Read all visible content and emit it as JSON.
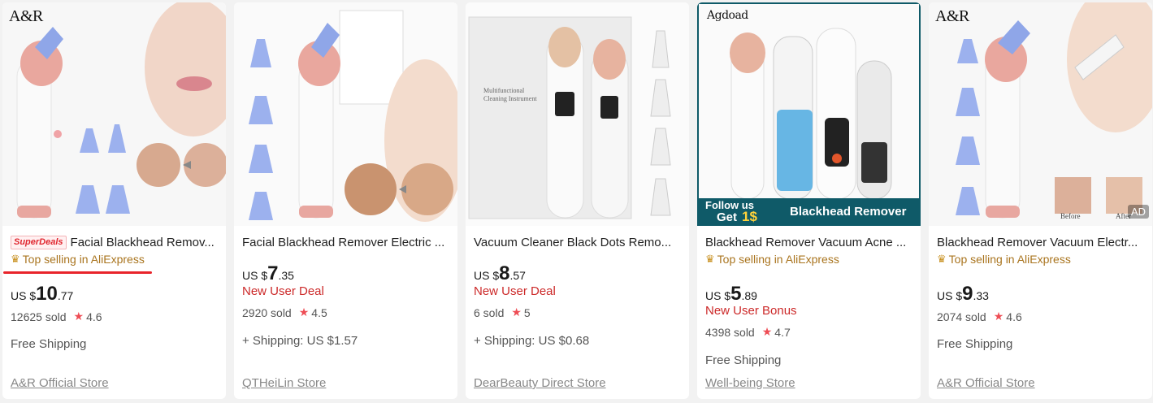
{
  "products": [
    {
      "brand_logo": "A&R",
      "badge": "SuperDeals",
      "title": "Facial Blackhead Remov...",
      "top_selling": "Top selling in AliExpress",
      "price_prefix": "US $",
      "price_main": "10",
      "price_cents": ".77",
      "sold": "12625 sold",
      "rating": "4.6",
      "shipping": "Free Shipping",
      "store": "A&R Official Store"
    },
    {
      "title": "Facial Blackhead Remover Electric ...",
      "price_prefix": "US $",
      "price_main": "7",
      "price_cents": ".35",
      "deal": "New User Deal",
      "sold": "2920 sold",
      "rating": "4.5",
      "shipping": "+ Shipping: US $1.57",
      "store": "QTHeiLin Store"
    },
    {
      "image_text": "Multifunctional Cleaning Instrument",
      "title": "Vacuum Cleaner Black Dots Remo...",
      "price_prefix": "US $",
      "price_main": "8",
      "price_cents": ".57",
      "deal": "New User Deal",
      "sold": "6 sold",
      "rating": "5",
      "shipping": "+ Shipping: US $0.68",
      "store": "DearBeauty Direct Store"
    },
    {
      "brand_logo": "Agdoad",
      "banner_follow": "Follow us",
      "banner_get": "Get",
      "banner_amount": "1$",
      "banner_title": "Blackhead Remover",
      "title": "Blackhead Remover Vacuum Acne ...",
      "top_selling": "Top selling in AliExpress",
      "price_prefix": "US $",
      "price_main": "5",
      "price_cents": ".89",
      "deal": "New User Bonus",
      "sold": "4398 sold",
      "rating": "4.7",
      "shipping": "Free Shipping",
      "store": "Well-being Store"
    },
    {
      "brand_logo": "A&R",
      "ad_label": "AD",
      "before_label": "Before",
      "after_label": "After",
      "title": "Blackhead Remover Vacuum Electr...",
      "top_selling": "Top selling in AliExpress",
      "price_prefix": "US $",
      "price_main": "9",
      "price_cents": ".33",
      "sold": "2074 sold",
      "rating": "4.6",
      "shipping": "Free Shipping",
      "store": "A&R Official Store"
    }
  ],
  "icons": {
    "crown": "crown-icon",
    "star": "star-icon"
  },
  "colors": {
    "deal_red": "#cc2929",
    "top_sell_gold": "#a9741e",
    "star_red": "#ee4d55",
    "banner_teal": "#0f5a68",
    "annotation_red": "#e8242a"
  }
}
